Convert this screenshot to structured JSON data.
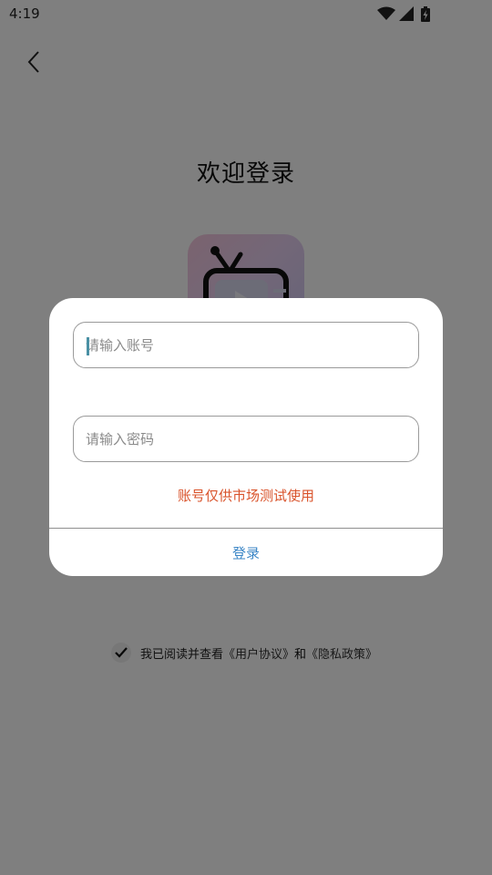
{
  "status_bar": {
    "time": "4:19",
    "icons": [
      "wifi-icon",
      "signal-icon",
      "battery-icon"
    ]
  },
  "header": {
    "title": "欢迎登录"
  },
  "agreement": {
    "prefix": "我已阅读并查看",
    "user_agreement": "《用户协议》",
    "and": "和",
    "privacy_policy": "《隐私政策》"
  },
  "dialog": {
    "account_placeholder": "请输入账号",
    "password_placeholder": "请输入密码",
    "notice": "账号仅供市场测试使用",
    "login_label": "登录"
  },
  "colors": {
    "notice": "#d9532b",
    "login": "#3b86c6",
    "overlay": "rgba(0,0,0,0.5)"
  }
}
